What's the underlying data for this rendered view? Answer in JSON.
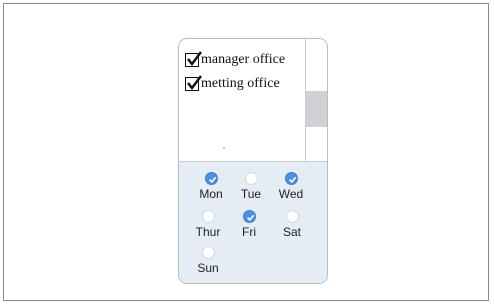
{
  "offices": [
    {
      "label": "manager office",
      "checked": true
    },
    {
      "label": "metting office",
      "checked": true
    }
  ],
  "days": [
    {
      "label": "Mon",
      "checked": true
    },
    {
      "label": "Tue",
      "checked": false
    },
    {
      "label": "Wed",
      "checked": true
    },
    {
      "label": "Thur",
      "checked": false
    },
    {
      "label": "Fri",
      "checked": true
    },
    {
      "label": "Sat",
      "checked": false
    },
    {
      "label": "Sun",
      "checked": false
    }
  ],
  "colors": {
    "accent": "#4a90e2",
    "panel_bg": "#e4ecf4",
    "scroll_thumb": "#cfd1d4"
  }
}
